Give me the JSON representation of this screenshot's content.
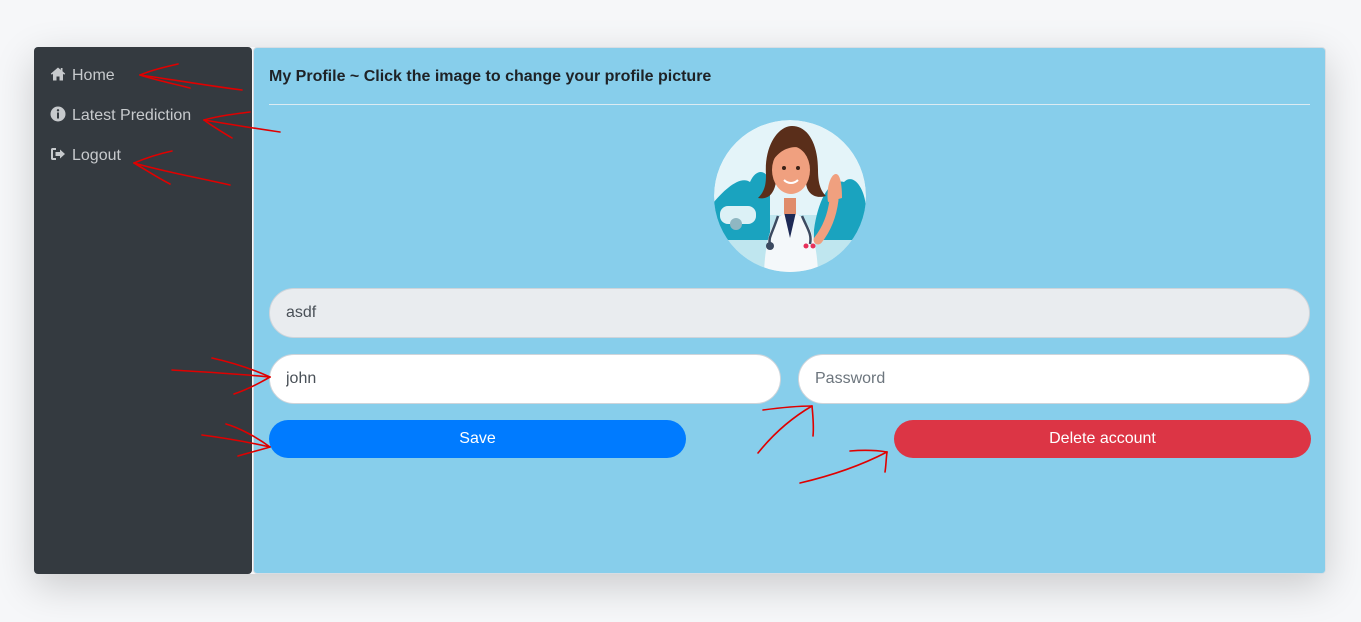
{
  "sidebar": {
    "items": [
      {
        "label": "Home",
        "icon": "home-icon"
      },
      {
        "label": "Latest Prediction",
        "icon": "info-icon"
      },
      {
        "label": "Logout",
        "icon": "logout-icon"
      }
    ]
  },
  "main": {
    "title": "My Profile ~ Click the image to change your profile picture"
  },
  "form": {
    "email_value": "asdf",
    "username_value": "john",
    "password_value": "",
    "password_placeholder": "Password",
    "save_label": "Save",
    "delete_label": "Delete account"
  },
  "colors": {
    "sidebar_bg": "#343a40",
    "main_bg": "#87ceeb",
    "save": "#007bff",
    "delete": "#dc3545",
    "annotation": "#e00000"
  }
}
